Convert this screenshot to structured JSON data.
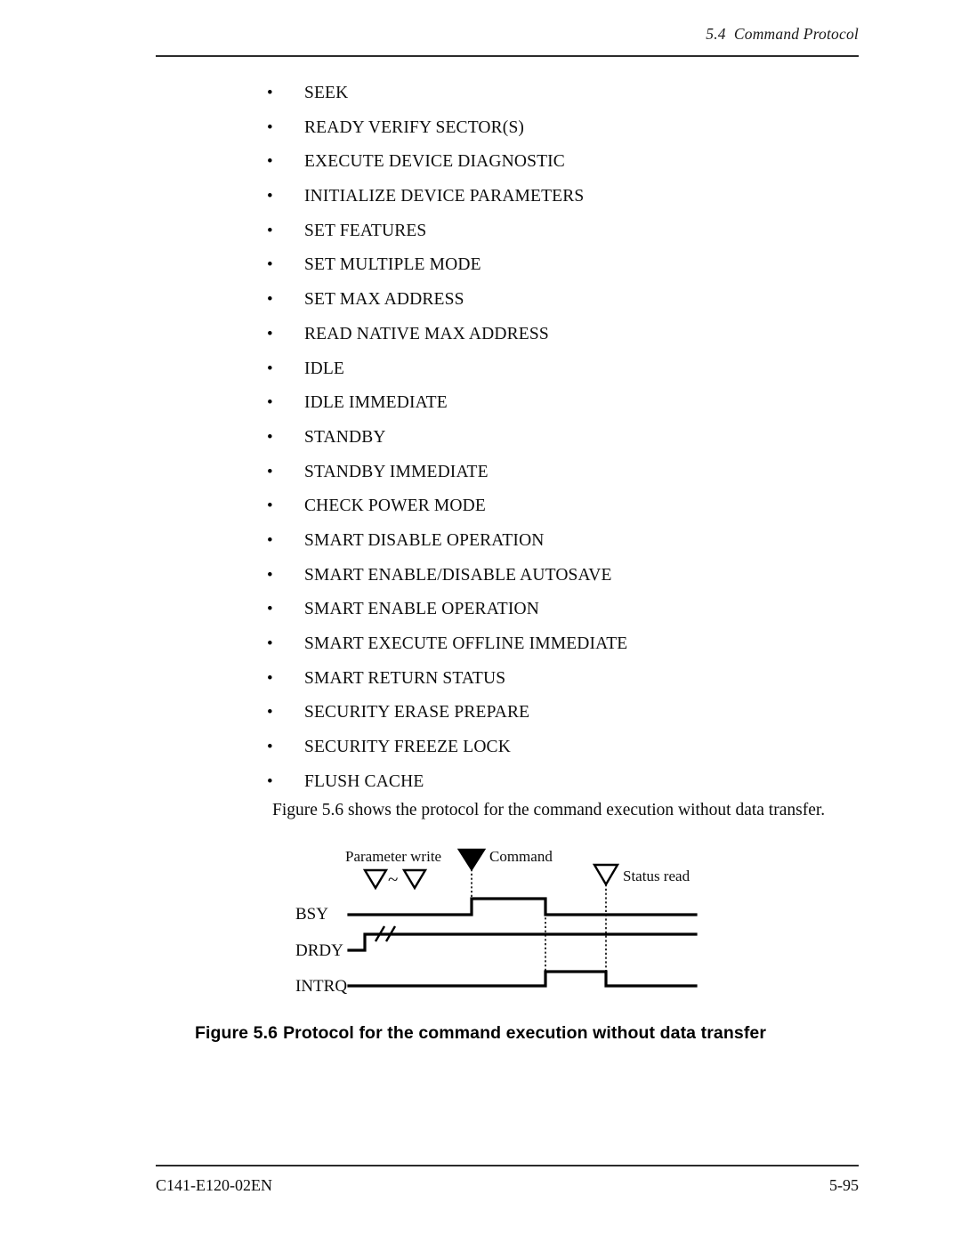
{
  "header": {
    "section_number": "5.4",
    "section_title": "Command Protocol",
    "full": "5.4  Command Protocol"
  },
  "command_list": {
    "bullet_glyph": "•",
    "items": [
      "SEEK",
      "READY VERIFY SECTOR(S)",
      "EXECUTE DEVICE DIAGNOSTIC",
      "INITIALIZE DEVICE PARAMETERS",
      "SET FEATURES",
      "SET MULTIPLE MODE",
      "SET MAX ADDRESS",
      "READ NATIVE MAX ADDRESS",
      "IDLE",
      "IDLE IMMEDIATE",
      "STANDBY",
      "STANDBY IMMEDIATE",
      "CHECK POWER MODE",
      "SMART DISABLE OPERATION",
      "SMART ENABLE/DISABLE AUTOSAVE",
      "SMART ENABLE OPERATION",
      "SMART EXECUTE OFFLINE IMMEDIATE",
      "SMART RETURN STATUS",
      "SECURITY ERASE PREPARE",
      "SECURITY FREEZE LOCK",
      "FLUSH CACHE"
    ]
  },
  "intro_paragraph": "Figure 5.6 shows the protocol for the command execution without data transfer.",
  "diagram": {
    "annotations": {
      "parameter_write": "Parameter write",
      "parameter_write_symbol": "▽~▽",
      "tilde": "~",
      "command": "Command",
      "status_read": "Status read"
    },
    "signals": [
      {
        "name": "BSY",
        "label": "BSY",
        "description": "low, rises at command write, falls at completion"
      },
      {
        "name": "DRDY",
        "label": "DRDY",
        "description": "rises early then high with break mark"
      },
      {
        "name": "INTRQ",
        "label": "INTRQ",
        "description": "low, rises at BSY fall, falls at status read"
      }
    ]
  },
  "figure_caption": {
    "number": "Figure 5.6",
    "text": "Protocol for the command execution without data transfer"
  },
  "footer": {
    "document_number": "C141-E120-02EN",
    "page_number": "5-95"
  }
}
